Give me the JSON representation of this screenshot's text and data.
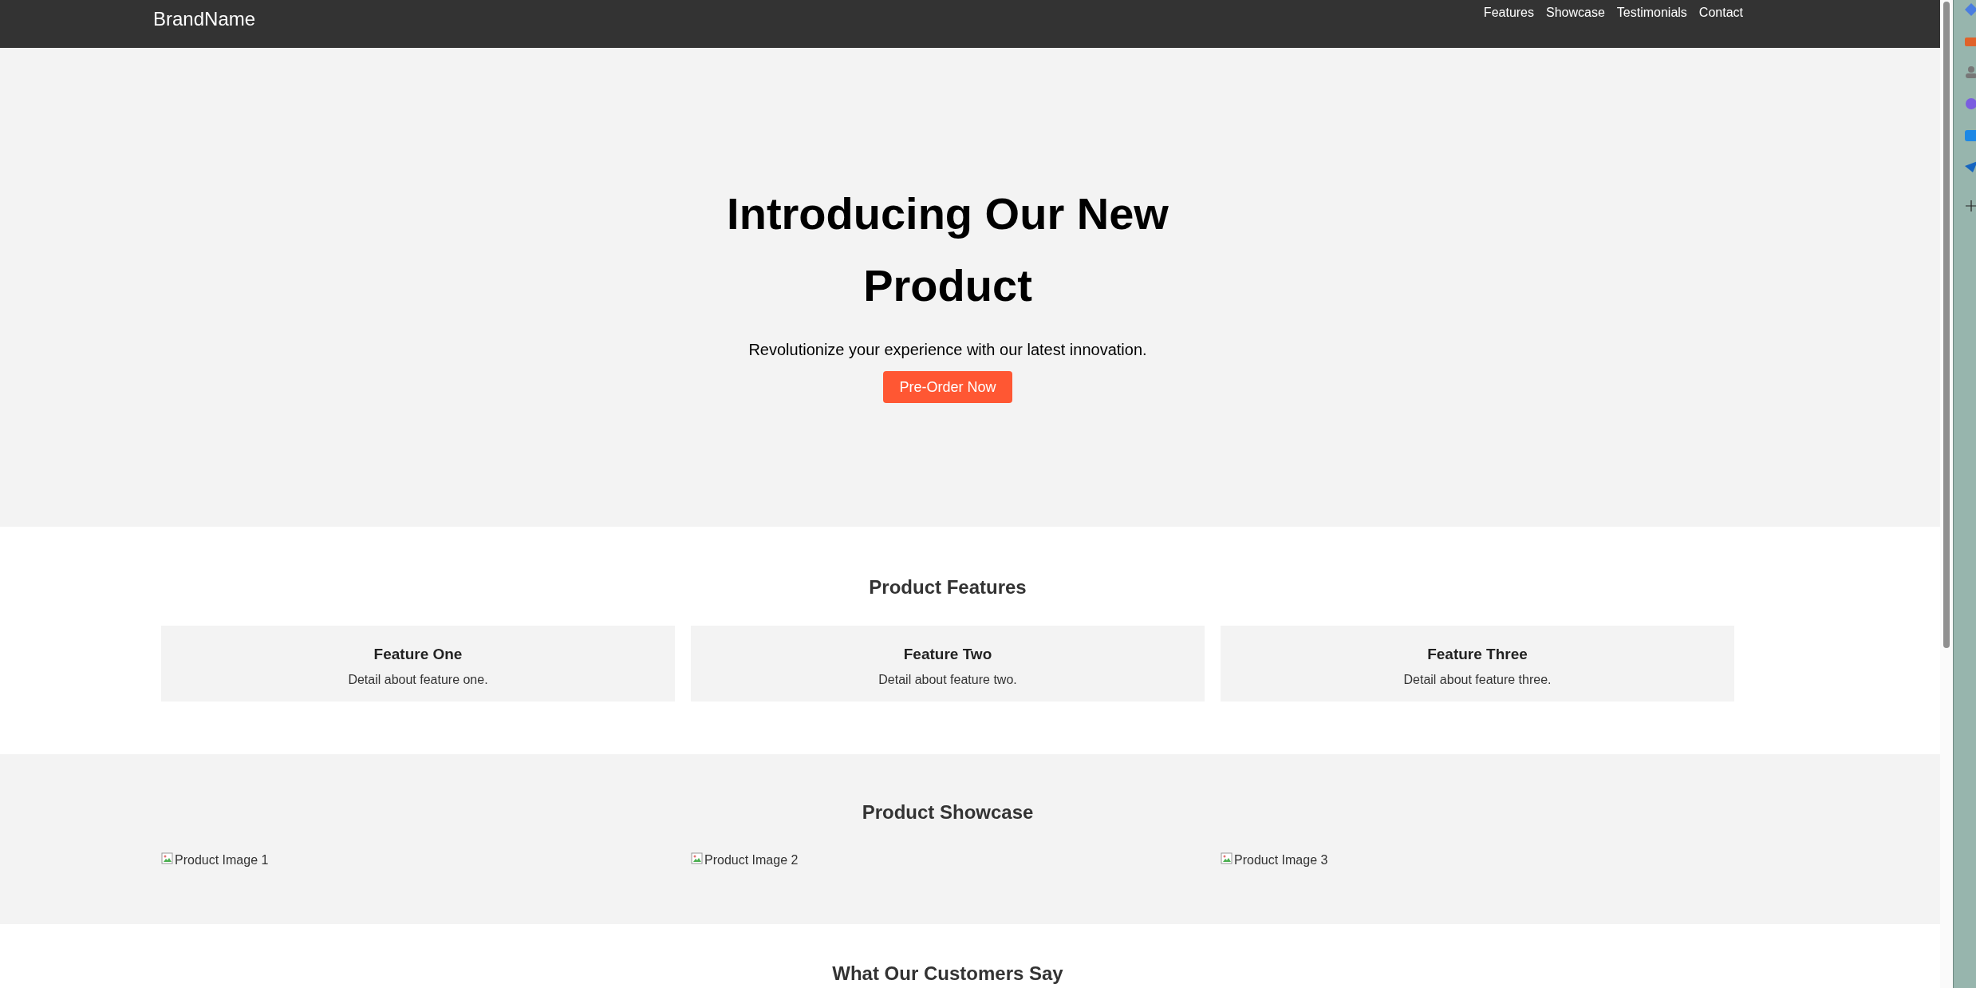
{
  "header": {
    "brand": "BrandName",
    "nav": [
      "Features",
      "Showcase",
      "Testimonials",
      "Contact"
    ]
  },
  "hero": {
    "title": "Introducing Our New Product",
    "subtitle": "Revolutionize your experience with our latest innovation.",
    "button": "Pre-Order Now"
  },
  "features": {
    "heading": "Product Features",
    "cards": [
      {
        "title": "Feature One",
        "detail": "Detail about feature one."
      },
      {
        "title": "Feature Two",
        "detail": "Detail about feature two."
      },
      {
        "title": "Feature Three",
        "detail": "Detail about feature three."
      }
    ]
  },
  "showcase": {
    "heading": "Product Showcase",
    "images": [
      "Product Image 1",
      "Product Image 2",
      "Product Image 3"
    ]
  },
  "testimonials": {
    "heading": "What Our Customers Say"
  }
}
